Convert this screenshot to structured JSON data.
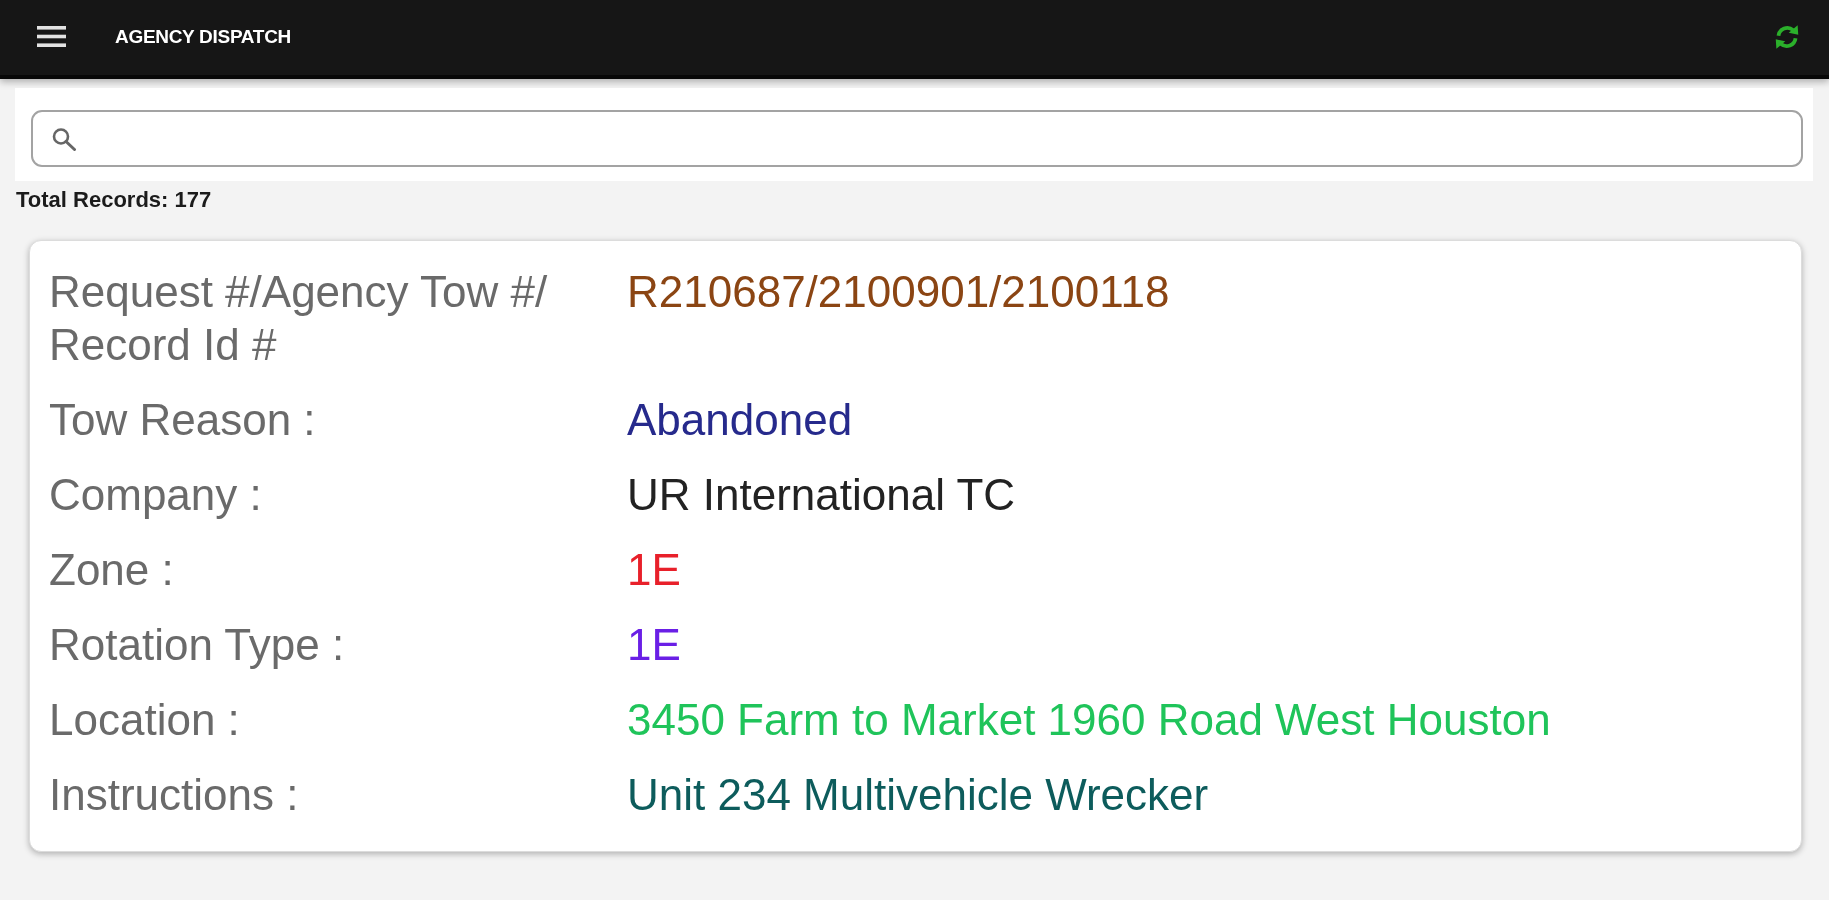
{
  "app_bar": {
    "title": "AGENCY DISPATCH"
  },
  "total_records": "Total Records: 177",
  "record": {
    "fields": [
      {
        "label": "Request #/Agency Tow #/ Record Id #",
        "value": "R210687/2100901/2100118",
        "color": "#8b4513"
      },
      {
        "label": "Tow Reason :",
        "value": "Abandoned",
        "color": "#262a8c"
      },
      {
        "label": "Company :",
        "value": "UR International TC",
        "color": "#222222"
      },
      {
        "label": "Zone :",
        "value": "1E",
        "color": "#e8202a"
      },
      {
        "label": "Rotation Type :",
        "value": "1E",
        "color": "#6a1fe6"
      },
      {
        "label": "Location :",
        "value": "3450 Farm to Market 1960 Road West Houston",
        "color": "#1fc45a"
      },
      {
        "label": "Instructions :",
        "value": "Unit 234 Multivehicle Wrecker",
        "color": "#0d5c5c"
      }
    ]
  }
}
